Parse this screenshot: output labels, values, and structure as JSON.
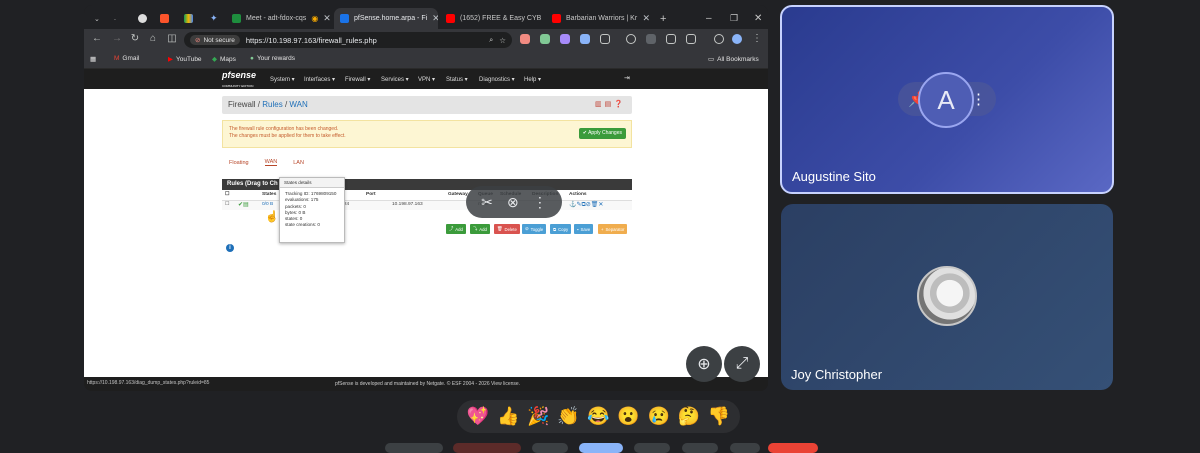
{
  "browser": {
    "tabs": [
      {
        "title": "Meet - adt-fdox-cqs",
        "favicon_color": "#1e8e3e"
      },
      {
        "title": "pfSense.home.arpa - Fi",
        "favicon_color": "#1a73e8"
      },
      {
        "title": "(1652) FREE & Easy CYB",
        "favicon_color": "#ff0000"
      },
      {
        "title": "Barbarian Warriors | Kr",
        "favicon_color": "#ff0000"
      }
    ],
    "new_tab_label": "+",
    "security_label": "Not secure",
    "url": "https://10.198.97.163/firewall_rules.php",
    "bookmarks": [
      "Gmail",
      "YouTube",
      "Maps",
      "Your rewards"
    ],
    "all_bookmarks_label": "All Bookmarks",
    "status_url": "https://10.198.97.163/diag_dump_states.php?ruleid=85"
  },
  "pfsense": {
    "logo_text": "pfsense",
    "logo_sub": "COMMUNITY EDITION",
    "menu": [
      "System ▾",
      "Interfaces ▾",
      "Firewall ▾",
      "Services ▾",
      "VPN ▾",
      "Status ▾",
      "Diagnostics ▾",
      "Help ▾"
    ],
    "breadcrumb": {
      "part1": "Firewall",
      "sep": "/",
      "part2": "Rules",
      "part3": "WAN"
    },
    "alert": {
      "line1": "The firewall rule configuration has been changed.",
      "line2": "The changes must be applied for them to take effect.",
      "apply_label": "Apply Changes"
    },
    "tabs": [
      "Floating",
      "WAN",
      "LAN"
    ],
    "rules_title": "Rules (Drag to Ch",
    "columns": [
      "States",
      "Port",
      "Gateway",
      "Queue",
      "Schedule",
      "Description",
      "Actions"
    ],
    "row": {
      "states": "0/0 B",
      "port": "*24",
      "gateway_ip": "10.198.97.163",
      "queue": "none"
    },
    "buttons": [
      {
        "label": "Add",
        "color": "#3b9b3b"
      },
      {
        "label": "Add",
        "color": "#3b9b3b"
      },
      {
        "label": "Delete",
        "color": "#d9534f"
      },
      {
        "label": "Toggle",
        "color": "#4b9fd5"
      },
      {
        "label": "Copy",
        "color": "#4b9fd5"
      },
      {
        "label": "Save",
        "color": "#4b9fd5"
      },
      {
        "label": "Separator",
        "color": "#f0ad4e"
      }
    ],
    "tooltip": {
      "title": "States details",
      "lines": [
        "Tracking ID: 1769809150",
        "evaluations: 175",
        "packets: 0",
        "bytes: 0 B",
        "states: 0",
        "state creations: 0"
      ]
    },
    "footer": "pfSense is developed and maintained by Netgate. © ESF 2004 - 2026 View license."
  },
  "participants": [
    {
      "name": "Augustine Sito",
      "initial": "A"
    },
    {
      "name": "Joy Christopher"
    }
  ],
  "reactions": [
    "💖",
    "👍",
    "🎉",
    "👏",
    "😂",
    "😮",
    "😢",
    "🤔",
    "👎"
  ]
}
